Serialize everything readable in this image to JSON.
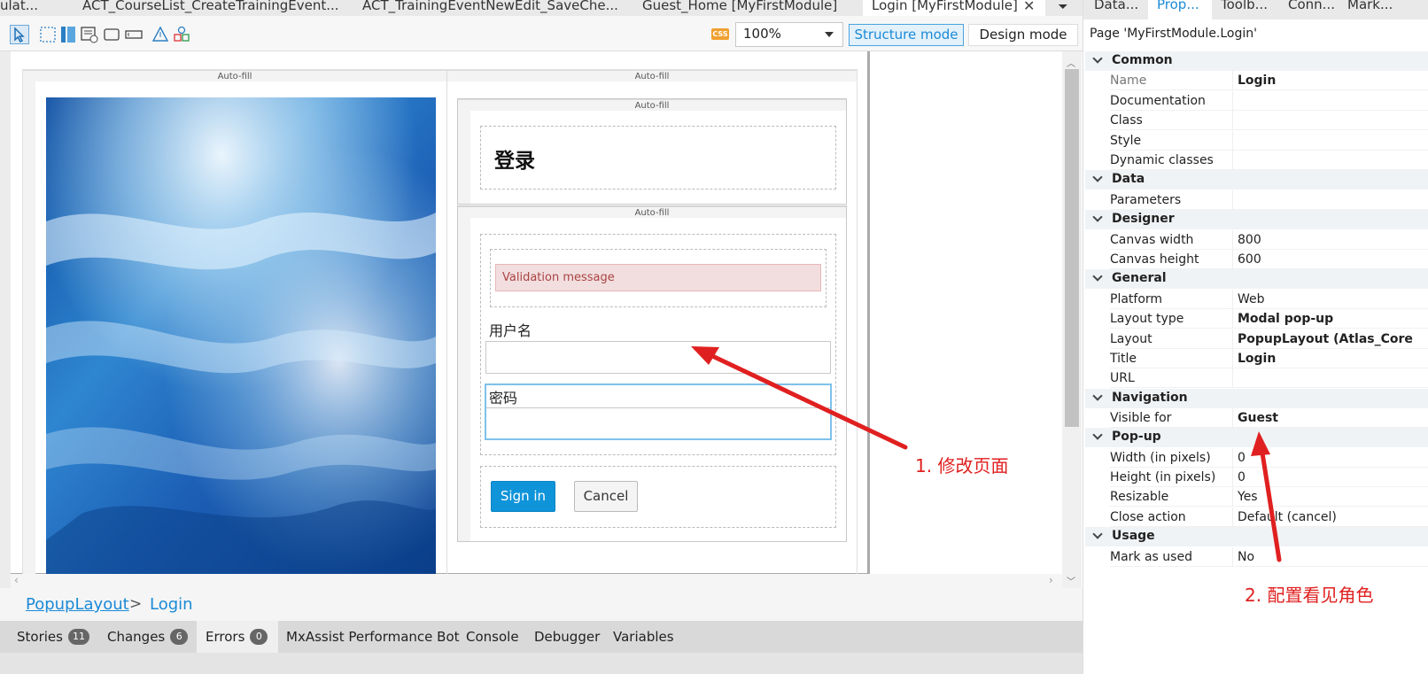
{
  "doc_tabs": [
    {
      "label": "ulat...",
      "active": false
    },
    {
      "label": "ACT_CourseList_CreateTrainingEvent...",
      "active": false
    },
    {
      "label": "ACT_TrainingEventNewEdit_SaveChe...",
      "active": false
    },
    {
      "label": "Guest_Home [MyFirstModule]",
      "active": false
    },
    {
      "label": "Login [MyFirstModule]",
      "active": true
    }
  ],
  "toolbar": {
    "css_badge": "CSS",
    "zoom": "100%",
    "structure_mode": "Structure mode",
    "design_mode": "Design mode"
  },
  "canvas": {
    "autofill_label": "Auto-fill",
    "login_title": "登录",
    "validation_message": "Validation message",
    "username_label": "用户名",
    "password_label": "密码",
    "signin_button": "Sign in",
    "cancel_button": "Cancel"
  },
  "breadcrumb": {
    "layout_link": "PopupLayout",
    "separator": ">",
    "current": "Login"
  },
  "bottom_tabs": [
    {
      "label": "Stories",
      "badge": "11"
    },
    {
      "label": "Changes",
      "badge": "6"
    },
    {
      "label": "Errors",
      "badge": "0"
    },
    {
      "label": "MxAssist Performance Bot"
    },
    {
      "label": "Console"
    },
    {
      "label": "Debugger"
    },
    {
      "label": "Variables"
    }
  ],
  "right_panel": {
    "tabs": [
      "Data...",
      "Prop...",
      "Toolb...",
      "Conn...",
      "Mark..."
    ],
    "active_tab": "Prop...",
    "header": "Page 'MyFirstModule.Login'",
    "categories": [
      {
        "title": "Common",
        "props": [
          {
            "name": "Name",
            "value": "Login",
            "dim": true,
            "bold": true
          },
          {
            "name": "Documentation",
            "value": ""
          },
          {
            "name": "Class",
            "value": ""
          },
          {
            "name": "Style",
            "value": ""
          },
          {
            "name": "Dynamic classes",
            "value": ""
          }
        ]
      },
      {
        "title": "Data",
        "props": [
          {
            "name": "Parameters",
            "value": ""
          }
        ]
      },
      {
        "title": "Designer",
        "props": [
          {
            "name": "Canvas width",
            "value": "800"
          },
          {
            "name": "Canvas height",
            "value": "600"
          }
        ]
      },
      {
        "title": "General",
        "props": [
          {
            "name": "Platform",
            "value": "Web"
          },
          {
            "name": "Layout type",
            "value": "Modal pop-up",
            "bold": true
          },
          {
            "name": "Layout",
            "value": "PopupLayout (Atlas_Core",
            "bold": true
          },
          {
            "name": "Title",
            "value": "Login",
            "bold": true
          },
          {
            "name": "URL",
            "value": ""
          }
        ]
      },
      {
        "title": "Navigation",
        "props": [
          {
            "name": "Visible for",
            "value": "Guest",
            "bold": true
          }
        ]
      },
      {
        "title": "Pop-up",
        "props": [
          {
            "name": "Width (in pixels)",
            "value": "0"
          },
          {
            "name": "Height (in pixels)",
            "value": "0"
          },
          {
            "name": "Resizable",
            "value": "Yes"
          },
          {
            "name": "Close action",
            "value": "Default (cancel)"
          }
        ]
      },
      {
        "title": "Usage",
        "props": [
          {
            "name": "Mark as used",
            "value": "No"
          }
        ]
      }
    ]
  },
  "annotations": {
    "note1": "1. 修改页面",
    "note2": "2. 配置看见角色",
    "color": "#e02020"
  }
}
